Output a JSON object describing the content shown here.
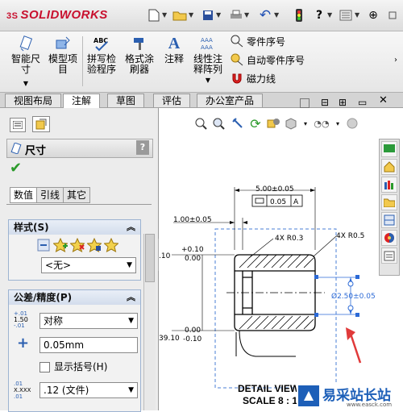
{
  "app": {
    "logo_text": "SOLIDWORKS",
    "logo_prefix": "3S"
  },
  "quick_access": {
    "new_icon": "new-doc-icon",
    "open_icon": "open-folder-icon",
    "save_icon": "save-icon",
    "print_icon": "print-icon",
    "undo_icon": "undo-icon",
    "rebuild_icon": "traffic-light-icon",
    "help_label": "?",
    "options_icon": "options-icon"
  },
  "ribbon": {
    "smart_dimension": "智能尺\n寸",
    "model_items": "模型项\n目",
    "spell_check": "拼写检\n验程序",
    "format_painter": "格式涂\n刷器",
    "note": "注释",
    "linear_pattern": "线性注\n释阵列",
    "balloon": "零件序号",
    "auto_balloon": "自动零件序号",
    "magnetic_line": "磁力线"
  },
  "tabs": [
    "视图布局",
    "注解",
    "草图",
    "评估",
    "办公室产品"
  ],
  "active_tab": 1,
  "property_manager": {
    "title": "尺寸",
    "help": "?",
    "subtabs": [
      "数值",
      "引线",
      "其它"
    ],
    "style_section": "样式(S)",
    "style_value": "<无>",
    "tolerance_section": "公差/精度(P)",
    "tolerance_type": "对称",
    "tolerance_value": "0.05mm",
    "show_parentheses": "显示括号(H)",
    "precision_value": ".12 (文件)"
  },
  "drawing": {
    "dim_top": "5.00±0.05",
    "gdt_flatness": "0.05",
    "gdt_datum": "A",
    "dim_left_top": "1.00±0.05",
    "chamfer_1": "4X R0.3",
    "chamfer_2": "4X R0.5",
    "tol_upper_1": "+0.10",
    "tol_lower_1": "0.00",
    "dim_left_frag": ".10",
    "dim_diameter": "Ø2.50±0.05",
    "tol_upper_2": "0.00",
    "tol_lower_2": "-0.10",
    "dim_left_frag2": "39.10",
    "detail_label": "DETAIL VIEW",
    "scale_label": "SCALE 8 : 1"
  },
  "watermark": {
    "brand": "易采站长站",
    "url": "www.easck.com"
  },
  "colors": {
    "accent": "#c8102e",
    "selection": "#2c6ad6",
    "arrow": "#e03a3a",
    "panel_header": "#d3ddec"
  }
}
